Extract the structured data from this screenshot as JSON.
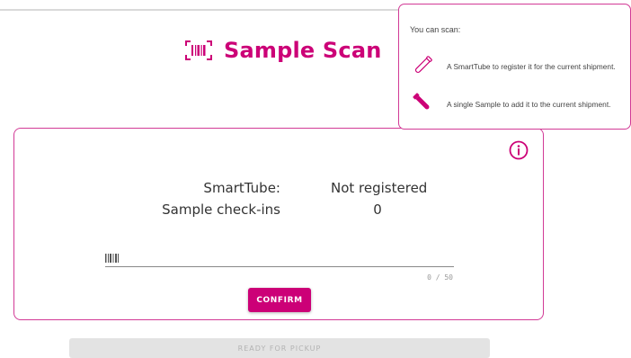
{
  "header": {
    "title": "Sample Scan",
    "icon": "barcode-scan-icon"
  },
  "tooltip": {
    "heading": "You can scan:",
    "items": [
      {
        "icon": "tube-outline-icon",
        "text": "A SmartTube to register it for the current shipment."
      },
      {
        "icon": "tube-filled-icon",
        "text": "A single Sample to add it to the current shipment."
      }
    ]
  },
  "card": {
    "info_icon": "info-icon",
    "rows": [
      {
        "label": "SmartTube:",
        "value": "Not registered"
      },
      {
        "label": "Sample check-ins",
        "value": "0"
      }
    ],
    "input": {
      "value": "",
      "icon": "barcode-icon",
      "counter": "0 / 50"
    },
    "confirm_label": "CONFIRM"
  },
  "footer": {
    "pickup_label": "READY FOR PICKUP"
  },
  "colors": {
    "accent": "#cc0077",
    "border": "#d23a96"
  }
}
